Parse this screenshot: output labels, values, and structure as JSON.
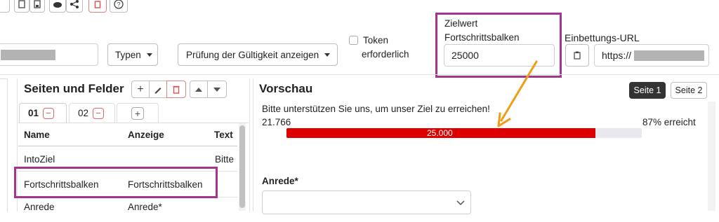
{
  "toolbar": {
    "typen_label": "Typen",
    "pruefung_label": "Prüfung der Gültigkeit anzeigen",
    "token_line1": "Token",
    "token_line2": "erforderlich",
    "zielwert_label_line1": "Zielwert",
    "zielwert_label_line2": "Fortschrittsbalken",
    "zielwert_value": "25000",
    "embed_label": "Einbettungs-URL",
    "embed_prefix": "https://"
  },
  "left_panel": {
    "title": "Seiten und Felder",
    "tabs": [
      "01",
      "02"
    ],
    "table_headers": {
      "name": "Name",
      "anzeige": "Anzeige",
      "text": "Text"
    },
    "rows": [
      {
        "name": "IntoZiel",
        "anzeige": "",
        "text": "Bitte"
      },
      {
        "name": "Fortschrittsbalken",
        "anzeige": "Fortschrittsbalken",
        "text": ""
      },
      {
        "name": "Anrede",
        "anzeige": "Anrede*",
        "text": ""
      }
    ]
  },
  "preview": {
    "title": "Vorschau",
    "pages": [
      "Seite 1",
      "Seite 2"
    ],
    "message": "Bitte unterstützen Sie uns, um unser Ziel zu erreichen!",
    "current_value": "21.766",
    "reached_text": "87% erreicht",
    "bar_label": "25.000",
    "progress_fraction": 0.87,
    "anrede_label": "Anrede*"
  },
  "colors": {
    "highlight": "#a5348f",
    "arrow": "#f29b16",
    "bar_fill": "#dd0000",
    "bar_track": "#e8e9ee"
  }
}
